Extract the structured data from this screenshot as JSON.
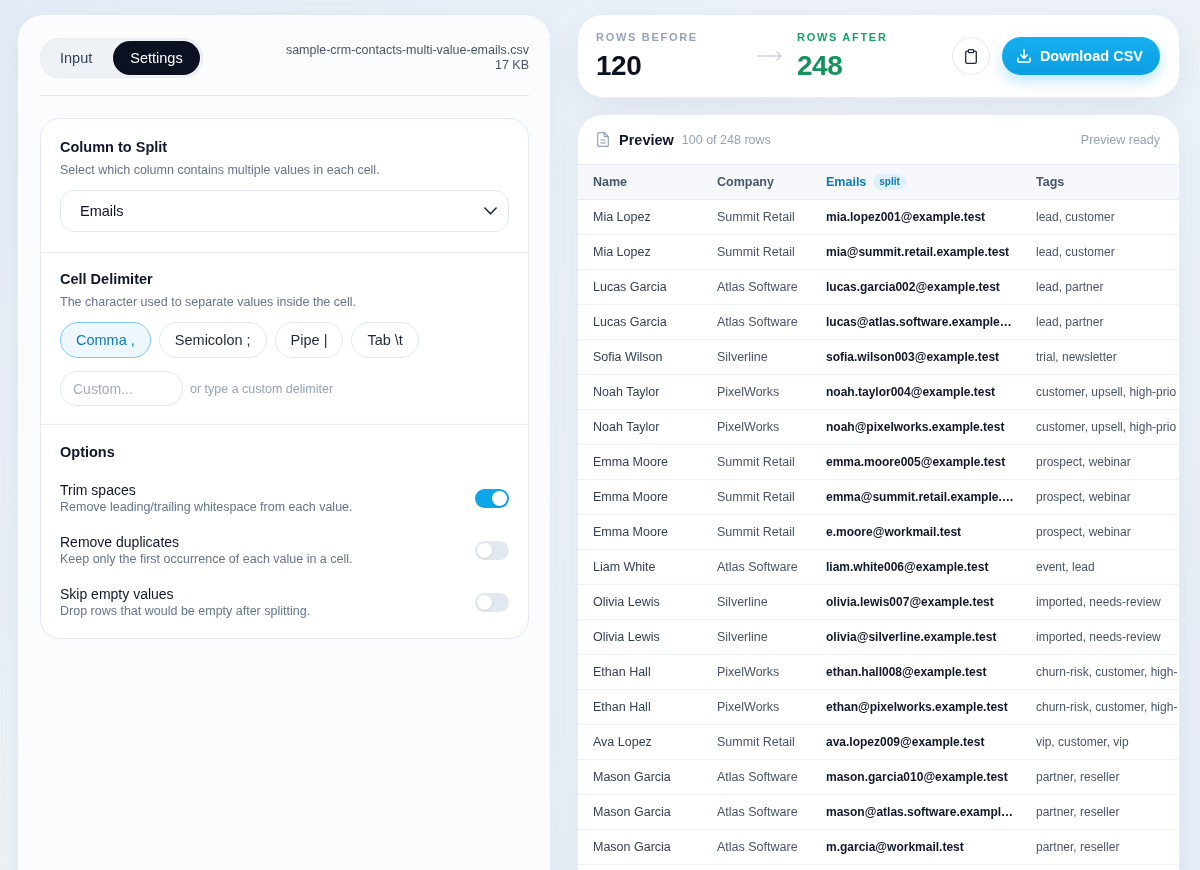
{
  "settings_panel": {
    "tabs": [
      {
        "label": "Input",
        "selected": false
      },
      {
        "label": "Settings",
        "selected": true
      }
    ],
    "file": {
      "name": "sample-crm-contacts-multi-value-emails.csv",
      "size": "17 KB"
    },
    "column_to_split": {
      "title": "Column to Split",
      "description": "Select which column contains multiple values in each cell.",
      "select": {
        "value": "Emails"
      }
    },
    "cell_delimiter": {
      "title": "Cell Delimiter",
      "description": "The character used to separate values inside the cell.",
      "options": [
        {
          "label": "Comma ,",
          "selected": true
        },
        {
          "label": "Semicolon ;",
          "selected": false
        },
        {
          "label": "Pipe |",
          "selected": false
        },
        {
          "label": "Tab \\t",
          "selected": false
        }
      ],
      "custom_field": {
        "placeholder": "Custom..."
      },
      "custom_hint": "or type a custom delimiter"
    },
    "options": {
      "title": "Options",
      "items": [
        {
          "label": "Trim spaces",
          "description": "Remove leading/trailing whitespace from each value.",
          "on": true
        },
        {
          "label": "Remove duplicates",
          "description": "Keep only the first occurrence of each value in a cell.",
          "on": false
        },
        {
          "label": "Skip empty values",
          "description": "Drop rows that would be empty after splitting.",
          "on": false
        }
      ]
    }
  },
  "summary": {
    "rows_before": {
      "label": "ROWS BEFORE",
      "value": "120"
    },
    "rows_after": {
      "label": "ROWS AFTER",
      "value": "248"
    },
    "download_button": {
      "label": "Download CSV"
    }
  },
  "preview": {
    "title": "Preview",
    "count": "100 of 248 rows",
    "status": "Preview ready",
    "columns": [
      {
        "label": "Name",
        "highlighted": false
      },
      {
        "label": "Company",
        "highlighted": false
      },
      {
        "label": "Emails",
        "highlighted": true,
        "badge": "split"
      },
      {
        "label": "Tags",
        "highlighted": false
      }
    ],
    "rows": [
      [
        "Mia Lopez",
        "Summit Retail",
        "mia.lopez001@example.test",
        "lead, customer"
      ],
      [
        "Mia Lopez",
        "Summit Retail",
        "mia@summit.retail.example.test",
        "lead, customer"
      ],
      [
        "Lucas Garcia",
        "Atlas Software",
        "lucas.garcia002@example.test",
        "lead, partner"
      ],
      [
        "Lucas Garcia",
        "Atlas Software",
        "lucas@atlas.software.example…",
        "lead, partner"
      ],
      [
        "Sofia Wilson",
        "Silverline",
        "sofia.wilson003@example.test",
        "trial, newsletter"
      ],
      [
        "Noah Taylor",
        "PixelWorks",
        "noah.taylor004@example.test",
        "customer, upsell, high-prio"
      ],
      [
        "Noah Taylor",
        "PixelWorks",
        "noah@pixelworks.example.test",
        "customer, upsell, high-prio"
      ],
      [
        "Emma Moore",
        "Summit Retail",
        "emma.moore005@example.test",
        "prospect, webinar"
      ],
      [
        "Emma Moore",
        "Summit Retail",
        "emma@summit.retail.example.…",
        "prospect, webinar"
      ],
      [
        "Emma Moore",
        "Summit Retail",
        "e.moore@workmail.test",
        "prospect, webinar"
      ],
      [
        "Liam White",
        "Atlas Software",
        "liam.white006@example.test",
        "event, lead"
      ],
      [
        "Olivia Lewis",
        "Silverline",
        "olivia.lewis007@example.test",
        "imported, needs-review"
      ],
      [
        "Olivia Lewis",
        "Silverline",
        "olivia@silverline.example.test",
        "imported, needs-review"
      ],
      [
        "Ethan Hall",
        "PixelWorks",
        "ethan.hall008@example.test",
        "churn-risk, customer, high-"
      ],
      [
        "Ethan Hall",
        "PixelWorks",
        "ethan@pixelworks.example.test",
        "churn-risk, customer, high-"
      ],
      [
        "Ava Lopez",
        "Summit Retail",
        "ava.lopez009@example.test",
        "vip, customer, vip"
      ],
      [
        "Mason Garcia",
        "Atlas Software",
        "mason.garcia010@example.test",
        "partner, reseller"
      ],
      [
        "Mason Garcia",
        "Atlas Software",
        "mason@atlas.software.exampl…",
        "partner, reseller"
      ],
      [
        "Mason Garcia",
        "Atlas Software",
        "m.garcia@workmail.test",
        "partner, reseller"
      ]
    ]
  }
}
